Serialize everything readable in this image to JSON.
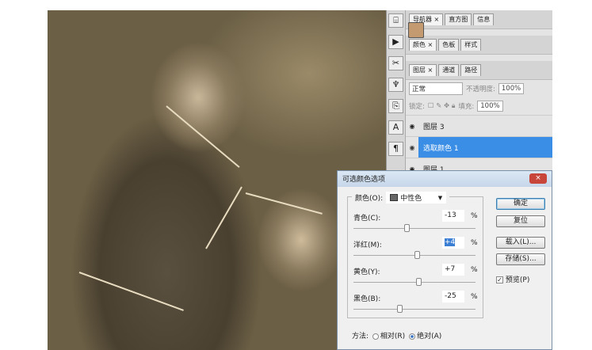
{
  "panels": {
    "group1_tabs": [
      "导航器 ×",
      "直方图",
      "信息"
    ],
    "group2_tabs": [
      "颜色 ×",
      "色板",
      "样式"
    ],
    "layers_tabs": [
      "图层 ×",
      "通道",
      "路径"
    ],
    "blend_mode": "正常",
    "opacity_label": "不透明度:",
    "opacity": "100%",
    "lock_label": "锁定:",
    "fill_label": "填充:",
    "fill": "100%",
    "layers": [
      {
        "name": "图层 3",
        "selected": false
      },
      {
        "name": "选取颜色 1",
        "selected": true
      },
      {
        "name": "图层 1",
        "selected": false
      }
    ]
  },
  "dialog": {
    "title": "可选颜色选项",
    "close": "×",
    "color_label": "颜色(O):",
    "color_value": "中性色",
    "sliders": [
      {
        "label": "青色(C):",
        "value": "-13",
        "num": -13
      },
      {
        "label": "洋红(M):",
        "value": "+4",
        "num": 4
      },
      {
        "label": "黄色(Y):",
        "value": "+7",
        "num": 7
      },
      {
        "label": "黑色(B):",
        "value": "-25",
        "num": -25
      }
    ],
    "pct": "%",
    "ok": "确定",
    "reset": "复位",
    "load": "载入(L)...",
    "save": "存储(S)...",
    "preview": "预览(P)",
    "preview_checked": true,
    "method_label": "方法:",
    "relative": "相对(R)",
    "absolute": "绝对(A)",
    "method_selected": "absolute"
  }
}
